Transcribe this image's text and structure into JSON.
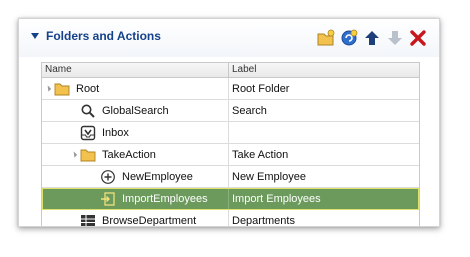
{
  "panel": {
    "title": "Folders and Actions",
    "toolbar": [
      {
        "name": "new-folder-button",
        "icon": "new-folder-icon"
      },
      {
        "name": "new-action-button",
        "icon": "new-action-icon"
      },
      {
        "name": "move-up-button",
        "icon": "arrow-up-icon"
      },
      {
        "name": "move-down-button",
        "icon": "arrow-down-icon"
      },
      {
        "name": "delete-button",
        "icon": "delete-x-icon"
      }
    ]
  },
  "grid": {
    "columns": [
      "Name",
      "Label"
    ],
    "rows": [
      {
        "name": "Root",
        "label": "Root Folder",
        "icon": "folder-icon",
        "expander": true,
        "indent": 0,
        "selected": false
      },
      {
        "name": "GlobalSearch",
        "label": "Search",
        "icon": "search-icon",
        "expander": false,
        "indent": 1,
        "selected": false
      },
      {
        "name": "Inbox",
        "label": "",
        "icon": "inbox-icon",
        "expander": false,
        "indent": 1,
        "selected": false
      },
      {
        "name": "TakeAction",
        "label": "Take Action",
        "icon": "folder-icon",
        "expander": true,
        "indent": 1,
        "selected": false
      },
      {
        "name": "NewEmployee",
        "label": "New Employee",
        "icon": "plus-circle-icon",
        "expander": false,
        "indent": 2,
        "selected": false
      },
      {
        "name": "ImportEmployees",
        "label": "Import Employees",
        "icon": "import-icon",
        "expander": false,
        "indent": 2,
        "selected": true
      },
      {
        "name": "BrowseDepartment",
        "label": "Departments",
        "icon": "table-icon",
        "expander": false,
        "indent": 1,
        "selected": false
      }
    ]
  },
  "colors": {
    "title": "#15418a",
    "selected_row": "#6b9a5c",
    "folder": "#f2c14e",
    "delete": "#c8161d"
  }
}
